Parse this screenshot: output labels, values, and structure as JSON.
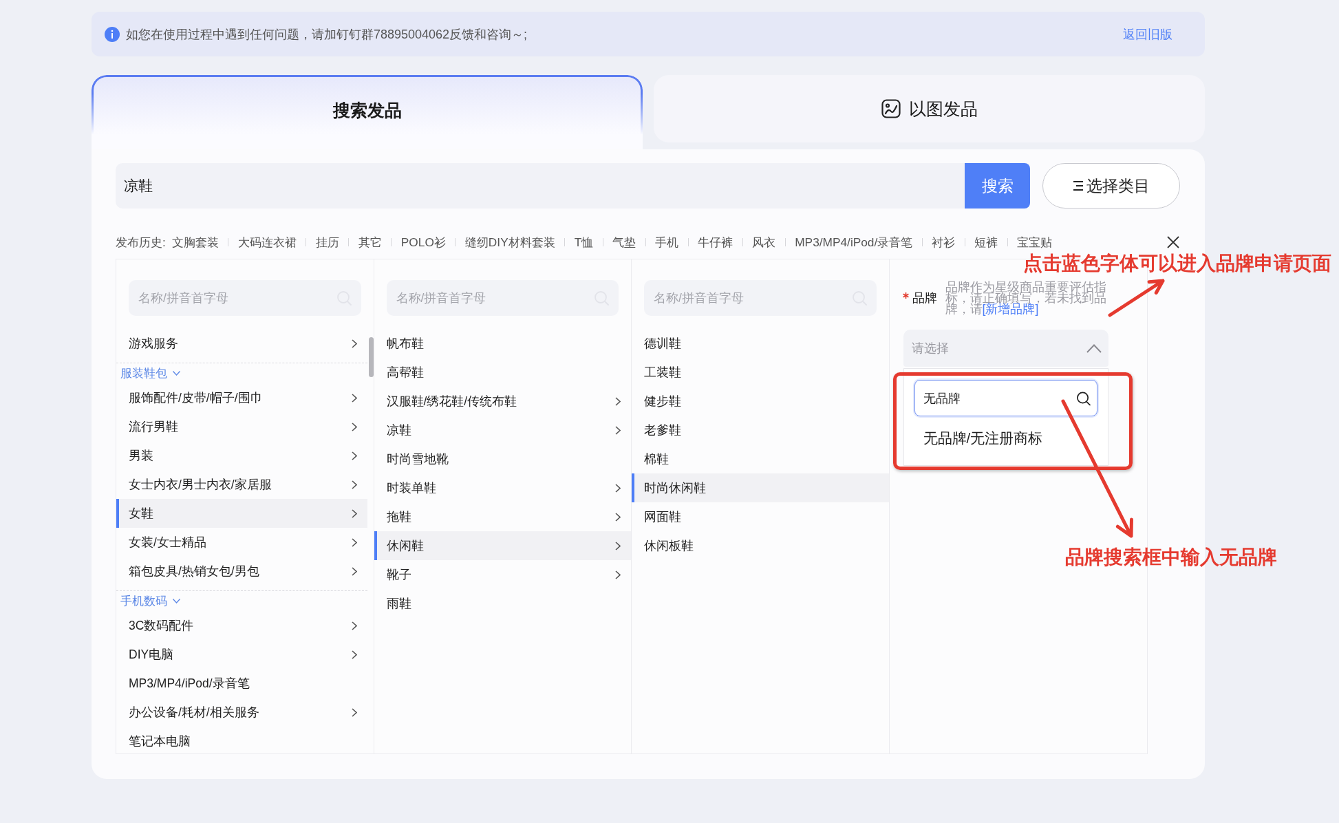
{
  "notice": {
    "text": "如您在使用过程中遇到任何问题，请加钉钉群78895004062反馈和咨询～;",
    "link": "返回旧版"
  },
  "tabs": [
    {
      "label": "搜索发品",
      "selected": true,
      "kind": "text"
    },
    {
      "label": "以图发品",
      "selected": false,
      "kind": "image"
    }
  ],
  "search": {
    "value": "凉鞋",
    "button": "搜索",
    "category_button": "选择类目"
  },
  "history": {
    "label": "发布历史:",
    "items": [
      "文胸套装",
      "大码连衣裙",
      "挂历",
      "其它",
      "POLO衫",
      "缝纫DIY材料套装",
      "T恤",
      "气垫",
      "手机",
      "牛仔裤",
      "风衣",
      "MP3/MP4/iPod/录音笔",
      "衬衫",
      "短裤",
      "宝宝贴"
    ]
  },
  "category_columns": [
    {
      "placeholder": "名称/拼音首字母",
      "scrollable": true,
      "items": [
        {
          "kind": "category",
          "label": "游戏服务",
          "expandable": true,
          "selected": false
        },
        {
          "kind": "group",
          "label": "服装鞋包",
          "expanded": true
        },
        {
          "kind": "category",
          "label": "服饰配件/皮带/帽子/围巾",
          "expandable": true,
          "selected": false
        },
        {
          "kind": "category",
          "label": "流行男鞋",
          "expandable": true,
          "selected": false
        },
        {
          "kind": "category",
          "label": "男装",
          "expandable": true,
          "selected": false
        },
        {
          "kind": "category",
          "label": "女士内衣/男士内衣/家居服",
          "expandable": true,
          "selected": false
        },
        {
          "kind": "category",
          "label": "女鞋",
          "expandable": true,
          "selected": true
        },
        {
          "kind": "category",
          "label": "女装/女士精品",
          "expandable": true,
          "selected": false
        },
        {
          "kind": "category",
          "label": "箱包皮具/热销女包/男包",
          "expandable": true,
          "selected": false
        },
        {
          "kind": "group",
          "label": "手机数码",
          "expanded": true
        },
        {
          "kind": "category",
          "label": "3C数码配件",
          "expandable": true,
          "selected": false
        },
        {
          "kind": "category",
          "label": "DIY电脑",
          "expandable": true,
          "selected": false
        },
        {
          "kind": "category",
          "label": "MP3/MP4/iPod/录音笔",
          "expandable": false,
          "selected": false
        },
        {
          "kind": "category",
          "label": "办公设备/耗材/相关服务",
          "expandable": true,
          "selected": false
        },
        {
          "kind": "category",
          "label": "笔记本电脑",
          "expandable": false,
          "selected": false
        }
      ]
    },
    {
      "placeholder": "名称/拼音首字母",
      "scrollable": false,
      "items": [
        {
          "kind": "category",
          "label": "帆布鞋",
          "expandable": false,
          "selected": false
        },
        {
          "kind": "category",
          "label": "高帮鞋",
          "expandable": false,
          "selected": false
        },
        {
          "kind": "category",
          "label": "汉服鞋/绣花鞋/传统布鞋",
          "expandable": true,
          "selected": false
        },
        {
          "kind": "category",
          "label": "凉鞋",
          "expandable": true,
          "selected": false
        },
        {
          "kind": "category",
          "label": "时尚雪地靴",
          "expandable": false,
          "selected": false
        },
        {
          "kind": "category",
          "label": "时装单鞋",
          "expandable": true,
          "selected": false
        },
        {
          "kind": "category",
          "label": "拖鞋",
          "expandable": true,
          "selected": false
        },
        {
          "kind": "category",
          "label": "休闲鞋",
          "expandable": true,
          "selected": true
        },
        {
          "kind": "category",
          "label": "靴子",
          "expandable": true,
          "selected": false
        },
        {
          "kind": "category",
          "label": "雨鞋",
          "expandable": false,
          "selected": false
        }
      ]
    },
    {
      "placeholder": "名称/拼音首字母",
      "scrollable": false,
      "items": [
        {
          "kind": "category",
          "label": "德训鞋",
          "expandable": false,
          "selected": false
        },
        {
          "kind": "category",
          "label": "工装鞋",
          "expandable": false,
          "selected": false
        },
        {
          "kind": "category",
          "label": "健步鞋",
          "expandable": false,
          "selected": false
        },
        {
          "kind": "category",
          "label": "老爹鞋",
          "expandable": false,
          "selected": false
        },
        {
          "kind": "category",
          "label": "棉鞋",
          "expandable": false,
          "selected": false
        },
        {
          "kind": "category",
          "label": "时尚休闲鞋",
          "expandable": false,
          "selected": true
        },
        {
          "kind": "category",
          "label": "网面鞋",
          "expandable": false,
          "selected": false
        },
        {
          "kind": "category",
          "label": "休闲板鞋",
          "expandable": false,
          "selected": false
        }
      ]
    }
  ],
  "brand": {
    "label": "品牌",
    "required": true,
    "help": "品牌作为星级商品重要评估指标，请正确填写，若未找到品牌，请",
    "link": "[新增品牌]",
    "select": {
      "placeholder": "请选择",
      "expanded": true
    },
    "dropdown": {
      "search_value": "无品牌",
      "options": [
        {
          "label": "无品牌/无注册商标",
          "selected": false
        }
      ]
    }
  },
  "annotations": [
    {
      "text": "点击蓝色字体可以进入品牌申请页面"
    },
    {
      "text": "品牌搜索框中输入无品牌"
    }
  ]
}
